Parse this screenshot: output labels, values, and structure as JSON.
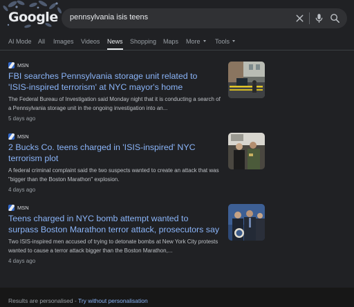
{
  "logo": {
    "text": "Google"
  },
  "search": {
    "query": "pennsylvania isis teens"
  },
  "tabs": [
    {
      "label": "AI Mode"
    },
    {
      "label": "All"
    },
    {
      "label": "Images"
    },
    {
      "label": "Videos"
    },
    {
      "label": "News",
      "active": true
    },
    {
      "label": "Shopping"
    },
    {
      "label": "Maps"
    },
    {
      "label": "More"
    },
    {
      "label": "Tools"
    }
  ],
  "results": [
    {
      "source": "MSN",
      "title": "FBI searches Pennsylvania storage unit related to 'ISIS-inspired terrorism' at NYC mayor's home",
      "snippet": "The Federal Bureau of Investigation said Monday night that it is conducting a search of a Pennsylvania storage unit in the ongoing investigation into an...",
      "age": "5 days ago"
    },
    {
      "source": "MSN",
      "title": "2 Bucks Co. teens charged in 'ISIS-inspired' NYC terrorism plot",
      "snippet": "A federal criminal complaint said the two suspects wanted to create an attack that was \"bigger than the Boston Marathon\" explosion.",
      "age": "4 days ago"
    },
    {
      "source": "MSN",
      "title": "Teens charged in NYC bomb attempt wanted to surpass Boston Marathon terror attack, prosecutors say",
      "snippet": "Two ISIS-inspired men accused of trying to detonate bombs at New York City protests wanted to cause a terror attack bigger than the Boston Marathon,...",
      "age": "4 days ago"
    }
  ],
  "footer": {
    "text": "Results are personalised - ",
    "link": "Try without personalisation"
  },
  "icons": {
    "clear": "close-icon",
    "voice": "microphone-icon",
    "search": "search-icon",
    "source": "msn-favicon"
  },
  "colors": {
    "background": "#202124",
    "link": "#8ab4f8",
    "search_box": "#303134",
    "footer": "#171717"
  }
}
